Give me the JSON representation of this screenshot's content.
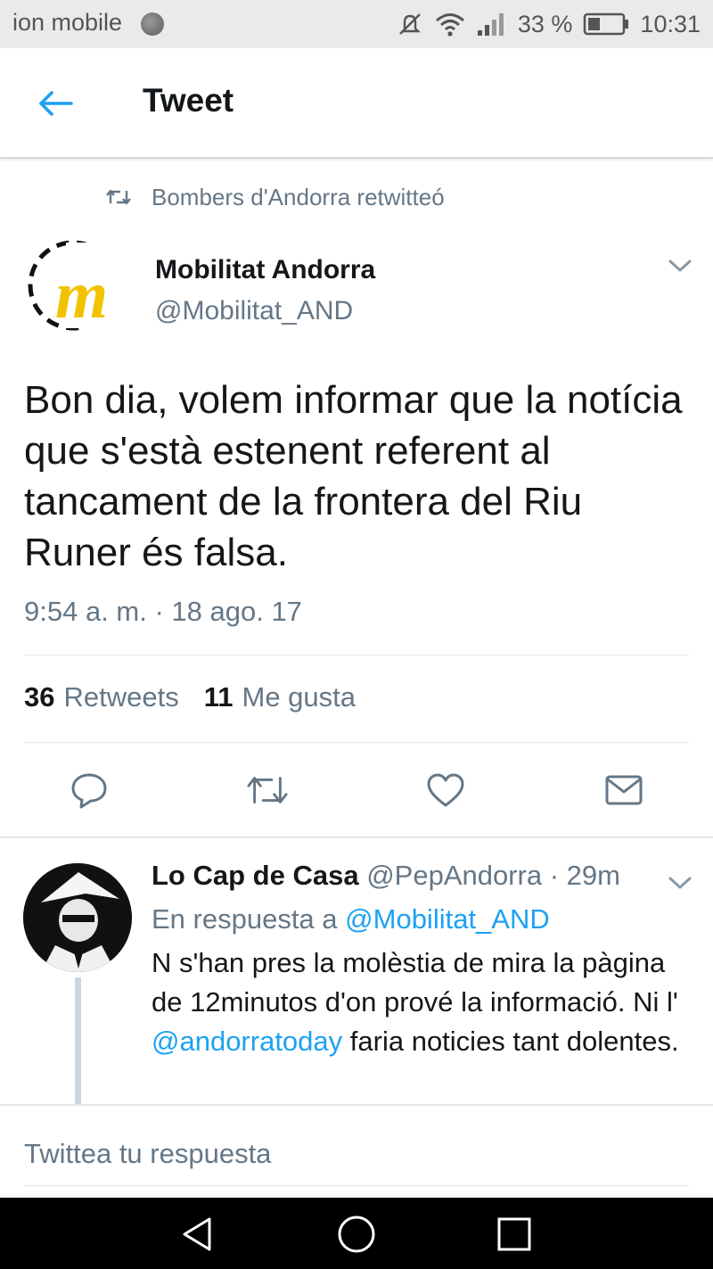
{
  "status_bar": {
    "carrier": "ion mobile",
    "battery": "33 %",
    "time": "10:31"
  },
  "app_bar": {
    "title": "Tweet"
  },
  "tweet": {
    "retweeted_by": "Bombers d'Andorra retwitteó",
    "author_name": "Mobilitat Andorra",
    "author_handle": "@Mobilitat_AND",
    "text": "Bon dia, volem informar que la notícia que s'està estenent referent al tancament de la frontera del Riu Runer és falsa.",
    "timestamp": "9:54 a. m. · 18 ago. 17",
    "retweets_count": "36",
    "retweets_label": "Retweets",
    "likes_count": "11",
    "likes_label": "Me gusta"
  },
  "reply": {
    "author_name": "Lo Cap de Casa",
    "author_handle": "@PepAndorra",
    "time": "· 29m",
    "in_reply_to_label": "En respuesta a",
    "in_reply_to_handle": "@Mobilitat_AND",
    "text_part1": "N s'han pres la molèstia de mira la pàgina de 12minutos d'on prové la informació. Ni l'",
    "mention": "@andorratoday",
    "text_part2": "faria noticies tant dolentes."
  },
  "compose": {
    "placeholder": "Twittea tu respuesta"
  },
  "colors": {
    "accent": "#1da1f2",
    "secondary_text": "#657786",
    "primary_text": "#14171a",
    "logo_yellow": "#f2c200"
  },
  "icons": [
    "back-arrow-icon",
    "retweet-icon",
    "chevron-down-icon",
    "reply-icon",
    "heart-icon",
    "mail-icon",
    "nav-back-icon",
    "nav-home-icon",
    "nav-recents-icon"
  ]
}
